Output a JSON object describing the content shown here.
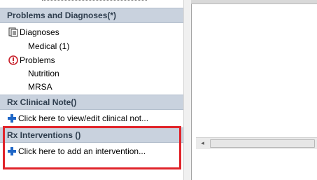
{
  "left_panel": {
    "problems_header": "Problems and Diagnoses(*)",
    "diagnoses_label": "Diagnoses",
    "medical_label": "Medical (1)",
    "problems_label": "Problems",
    "nutrition_label": "Nutrition",
    "mrsa_label": "MRSA",
    "rx_clinical_note_header": "Rx Clinical Note()",
    "clinical_note_link": "Click here to view/edit clinical not...",
    "rx_interventions_header": "Rx Interventions ()",
    "add_intervention_link": "Click here to add an intervention..."
  },
  "scrollbar": {
    "left_arrow": "◂"
  },
  "colors": {
    "highlight": "#e0242a",
    "header_bg": "#c9d2de",
    "plus_icon": "#1f66c6",
    "alert_icon": "#c8202a"
  }
}
